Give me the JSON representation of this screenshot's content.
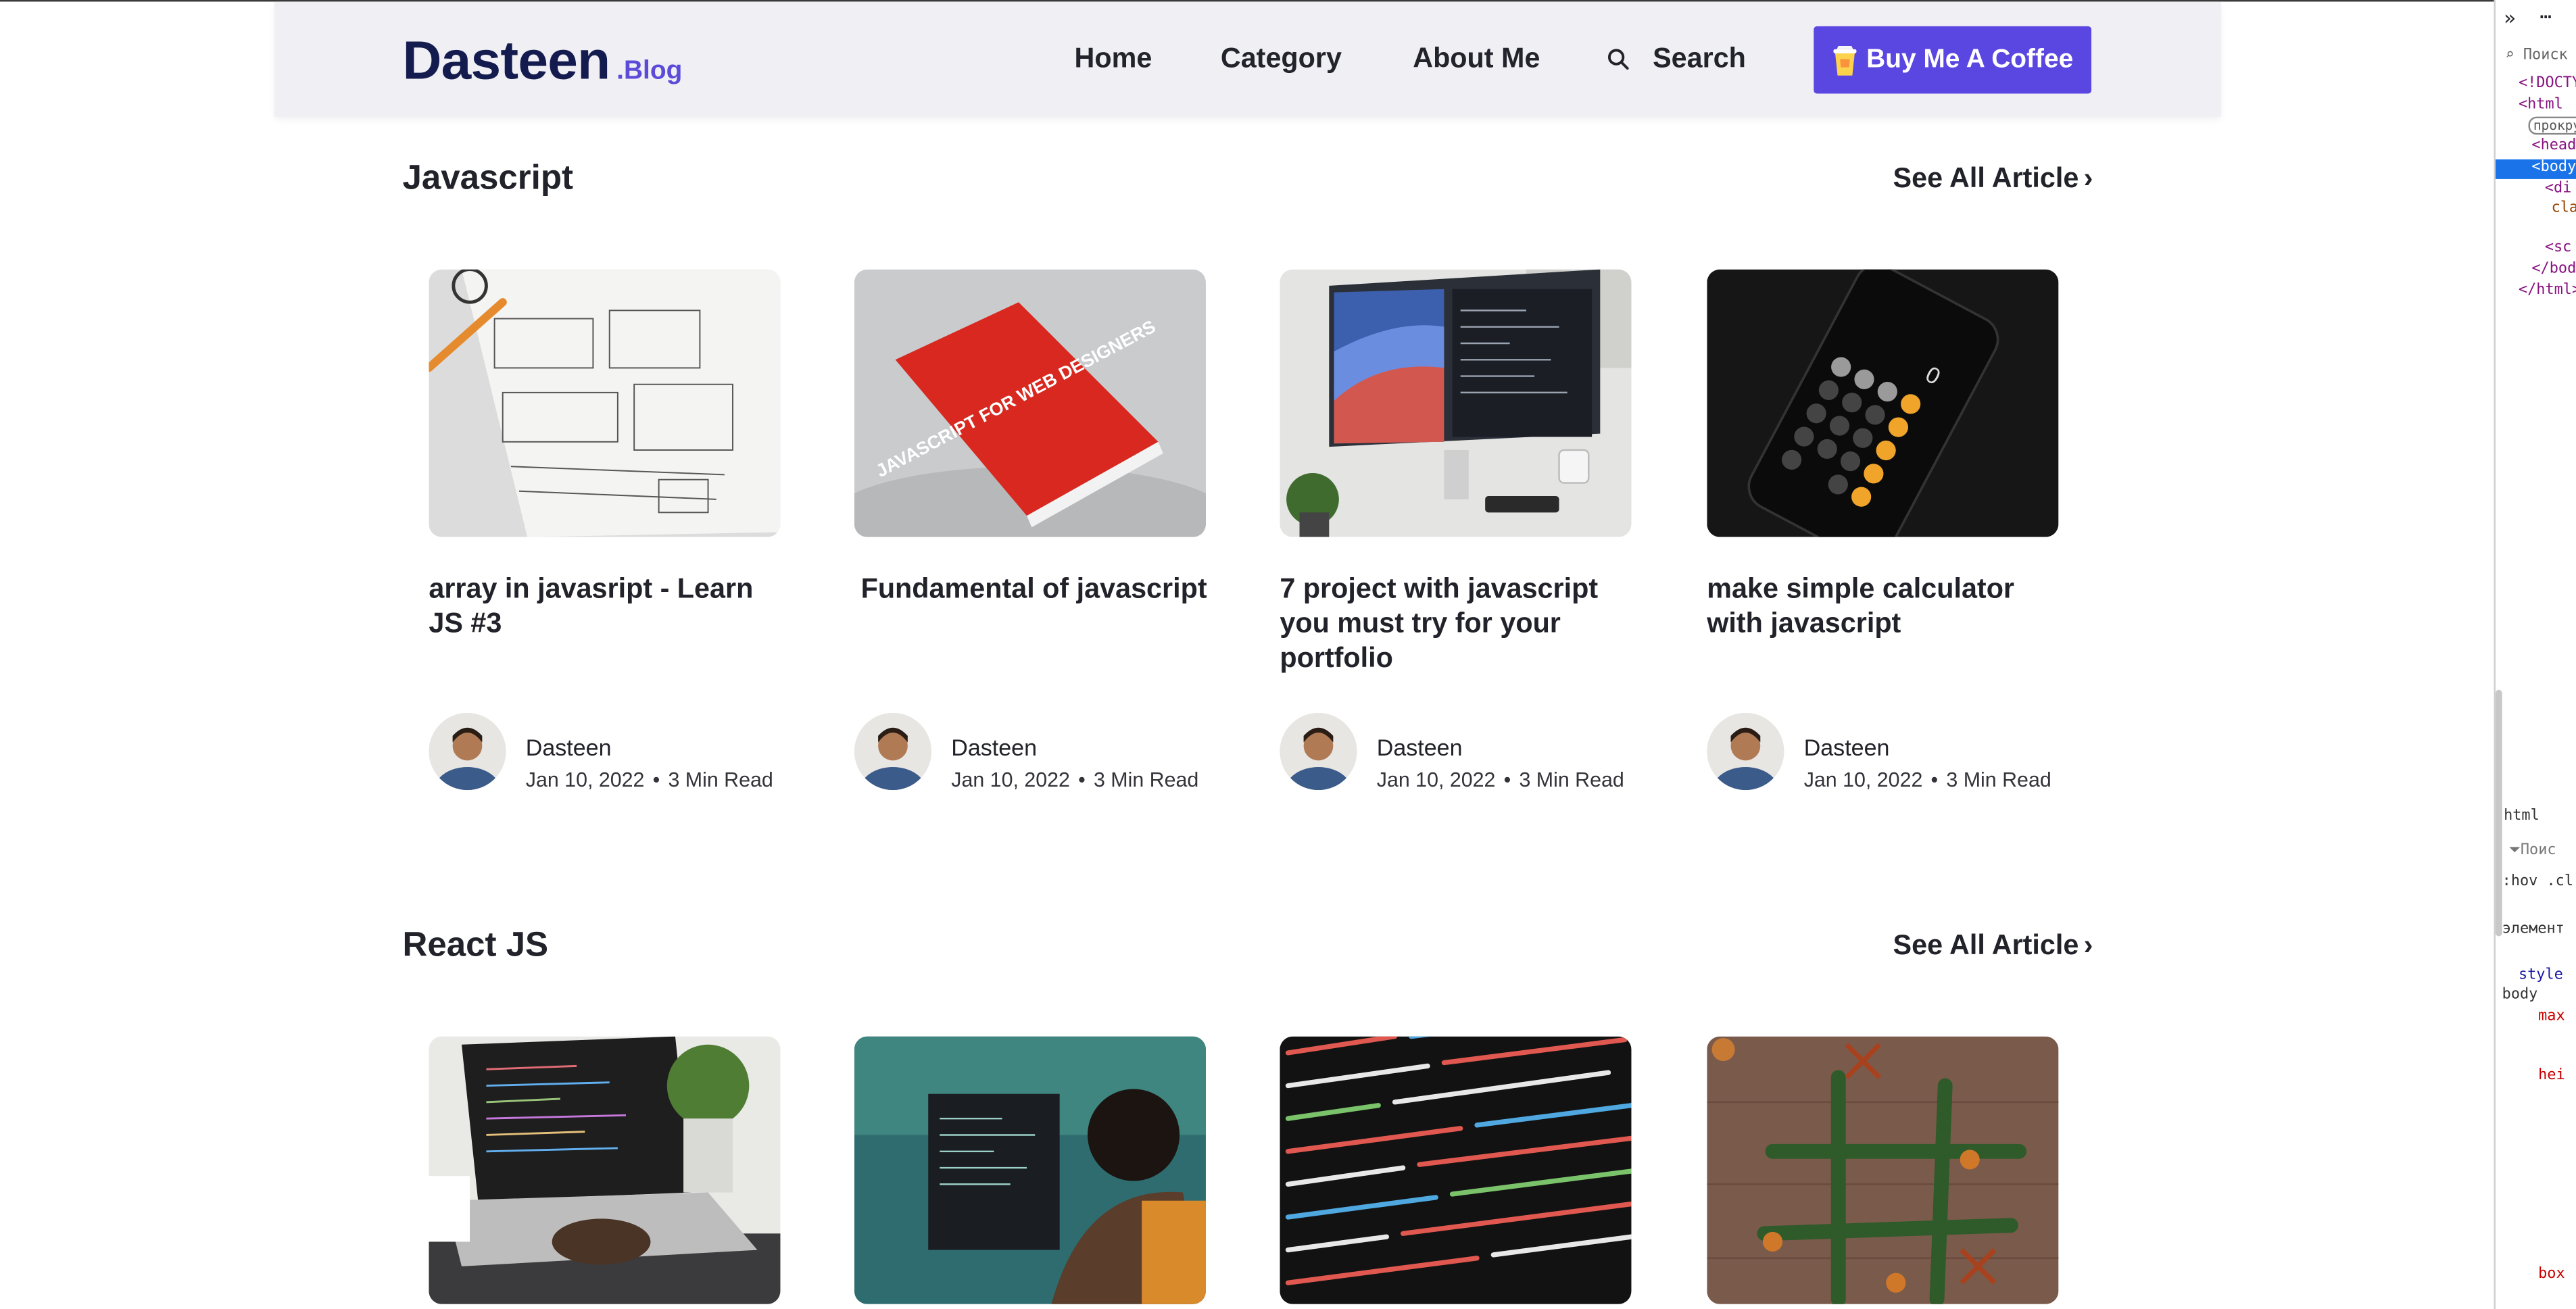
{
  "header": {
    "logo_main": "Dasteen",
    "logo_sub": ".Blog",
    "nav": {
      "home": "Home",
      "category": "Category",
      "about": "About Me",
      "search": "Search"
    },
    "coffee_button": "Buy Me A Coffee"
  },
  "sections": [
    {
      "title": "Javascript",
      "see_all": "See All Article",
      "cards": [
        {
          "title": "array in javasript - Learn JS #3",
          "author": "Dasteen",
          "date": "Jan 10, 2022",
          "read": "3 Min Read"
        },
        {
          "title": "Fundamental of javascript",
          "author": "Dasteen",
          "date": "Jan 10, 2022",
          "read": "3 Min Read"
        },
        {
          "title": "7 project with javascript you must try for your portfolio",
          "author": "Dasteen",
          "date": "Jan 10, 2022",
          "read": "3 Min Read"
        },
        {
          "title": "make simple calculator with javascript",
          "author": "Dasteen",
          "date": "Jan 10, 2022",
          "read": "3 Min Read"
        }
      ]
    },
    {
      "title": "React JS",
      "see_all": "See All Article"
    }
  ],
  "book_cover_text": "JAVASCRIPT FOR WEB DESIGNERS",
  "devtools": {
    "search_placeholder": "Поиск",
    "lines": [
      "<!DOCTY",
      "<html",
      "прокру",
      "<head",
      "<body",
      "<di",
      "cla",
      "<sc",
      "</bod",
      "</html>"
    ],
    "breadcrumb": "html",
    "filter": "Поис",
    "hov": ":hov .cl",
    "element_label": "элемент",
    "style_label": "style",
    "body_label": "body",
    "max_label": "max",
    "hei_label": "hei",
    "box_label": "box"
  },
  "colors": {
    "accent": "#5a46e0",
    "logo": "#141b4f",
    "header_bg": "#efeff4"
  }
}
